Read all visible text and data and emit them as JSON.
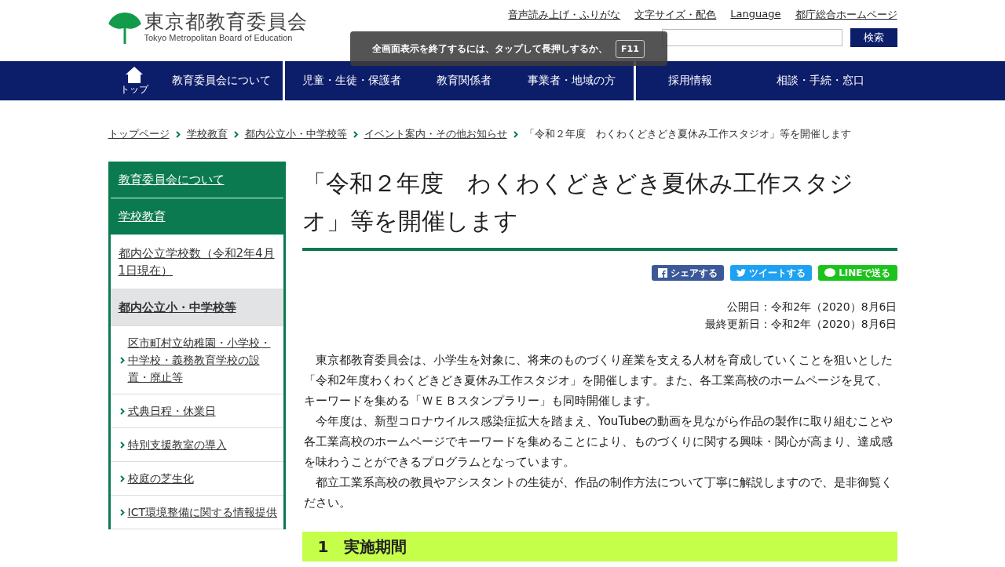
{
  "logo": {
    "title": "東京都教育委員会",
    "subtitle": "Tokyo Metropolitan Board of Education"
  },
  "utility_links": [
    "音声読み上げ・ふりがな",
    "文字サイズ・配色",
    "Language",
    "都庁総合ホームページ"
  ],
  "search": {
    "button": "検索"
  },
  "overlay": {
    "message": "全画面表示を終了するには、タップして長押しするか、",
    "key": "F11"
  },
  "nav": [
    [
      {
        "label": "トップ",
        "kind": "home"
      },
      {
        "label": "教育委員会について",
        "kind": "link"
      }
    ],
    [
      {
        "label": "児童・生徒・保護者",
        "kind": "link"
      },
      {
        "label": "教育関係者",
        "kind": "link"
      },
      {
        "label": "事業者・地域の方",
        "kind": "link"
      }
    ],
    [
      {
        "label": "採用情報",
        "kind": "link"
      },
      {
        "label": "相談・手続・窓口",
        "kind": "link"
      }
    ]
  ],
  "breadcrumb": {
    "links": [
      "トップページ",
      "学校教育",
      "都内公立小・中学校等",
      "イベント案内・その他お知らせ"
    ],
    "current": "「令和２年度　わくわくどきどき夏休み工作スタジオ」等を開催します"
  },
  "sidebar": [
    {
      "label": "教育委員会について",
      "kind": "section",
      "selected": false
    },
    {
      "label": "学校教育",
      "kind": "section",
      "selected": false
    },
    {
      "label": "都内公立学校数（令和2年4月1日現在）",
      "kind": "page",
      "selected": false
    },
    {
      "label": "都内公立小・中学校等",
      "kind": "page",
      "selected": true
    },
    {
      "label": "区市町村立幼稚園・小学校・中学校・義務教育学校の設置・廃止等",
      "kind": "child",
      "selected": false
    },
    {
      "label": "式典日程・休業日",
      "kind": "child",
      "selected": false
    },
    {
      "label": "特別支援教室の導入",
      "kind": "child",
      "selected": false
    },
    {
      "label": "校庭の芝生化",
      "kind": "child",
      "selected": false
    },
    {
      "label": "ICT環境整備に関する情報提供",
      "kind": "child",
      "selected": false
    }
  ],
  "article": {
    "title": "「令和２年度　わくわくどきどき夏休み工作スタジオ」等を開催します",
    "share_buttons": [
      {
        "label": "シェアする",
        "kind": "facebook"
      },
      {
        "label": "ツイートする",
        "kind": "twitter"
      },
      {
        "label": "LINEで送る",
        "kind": "line"
      }
    ],
    "dates": [
      "公開日：令和2年（2020）8月6日",
      "最終更新日：令和2年（2020）8月6日"
    ],
    "paragraphs": [
      "東京都教育委員会は、小学生を対象に、将来のものづくり産業を支える人材を育成していくことを狙いとした「令和2年度わくわくどきどき夏休み工作スタジオ」を開催します。また、各工業高校のホームページを見て、キーワードを集める「ＷＥＢスタンプラリー」も同時開催します。",
      "今年度は、新型コロナウイルス感染症拡大を踏まえ、YouTubeの動画を見ながら作品の製作に取り組むことや各工業高校のホームページでキーワードを集めることにより、ものづくりに関する興味・関心が高まり、達成感を味わうことができるプログラムとなっています。",
      "都立工業系高校の教員やアシスタントの生徒が、作品の制作方法について丁寧に解説しますので、是非御覧ください。"
    ],
    "section_heading": "1　実施期間"
  }
}
